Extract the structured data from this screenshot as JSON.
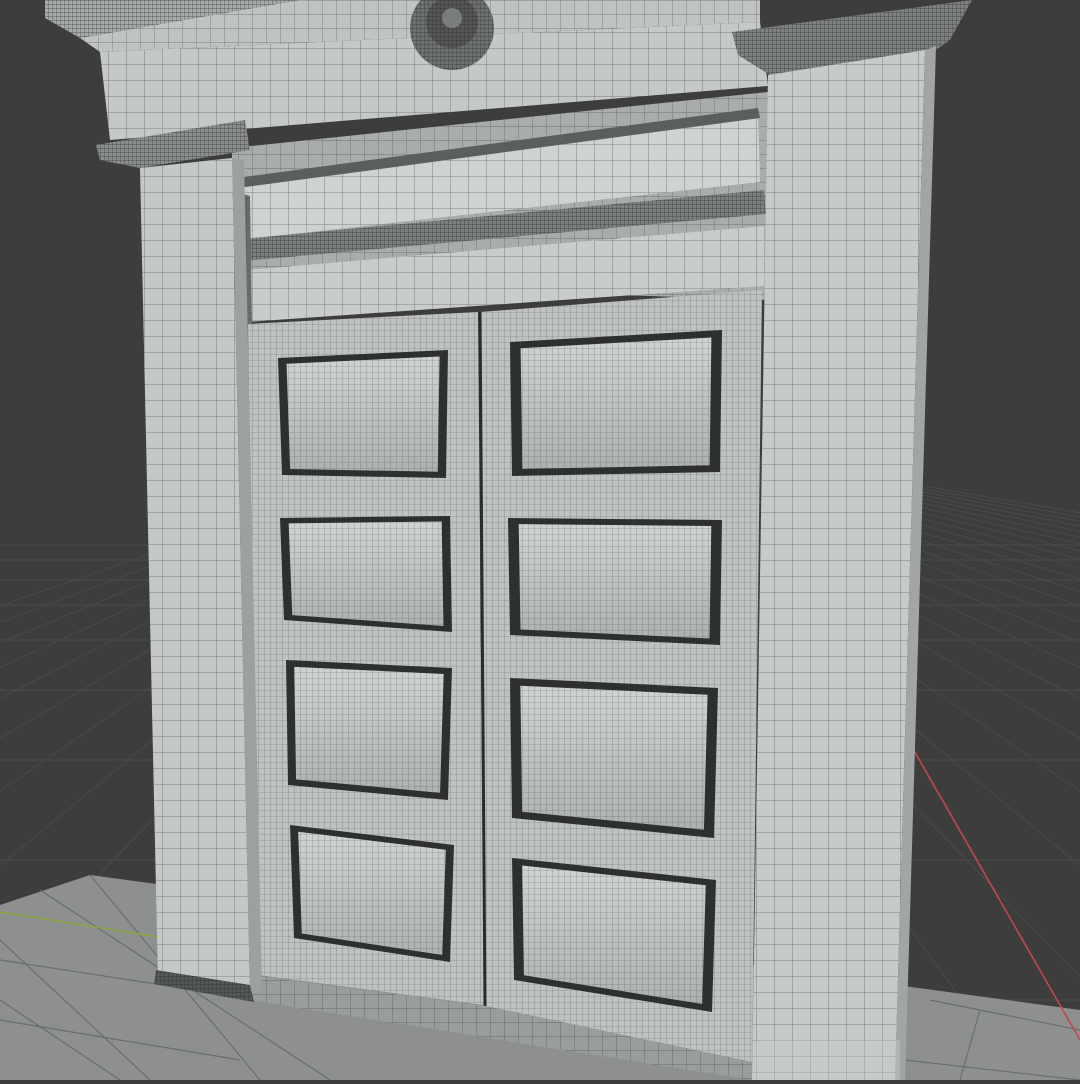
{
  "viewport": {
    "kind": "3d-viewport-wireframe",
    "background_color": "#3d3d3d",
    "grid_color": "#4a4a4a",
    "x_axis_color": "#c0484f",
    "y_axis_color": "#8fa63c",
    "floor_color": "#8e9090",
    "mesh_base_color": "#c5c8c8",
    "mesh_shadow_color": "#9ea1a1",
    "wire_color": "#2b2b2b"
  },
  "model": {
    "object": "double-door-with-pilasters",
    "door_leaves": 2,
    "panels_per_leaf": 4,
    "top_ornament": "rosette"
  }
}
